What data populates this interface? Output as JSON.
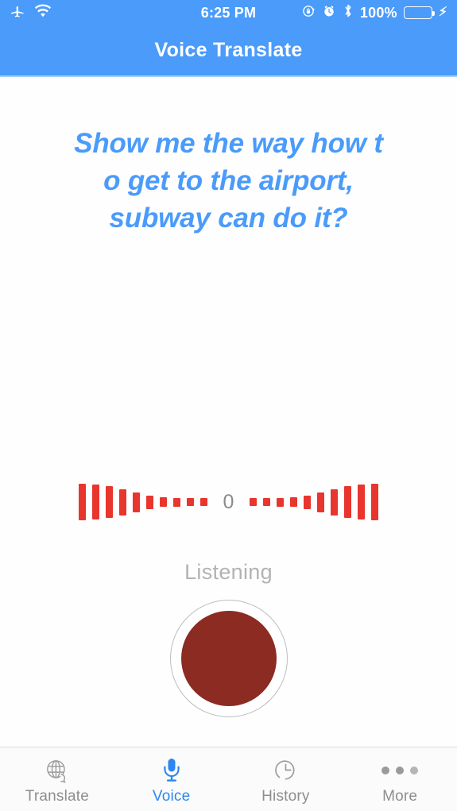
{
  "statusbar": {
    "airplane_icon": "airplane-icon",
    "wifi_icon": "wifi-icon",
    "time": "6:25 PM",
    "rotation_lock_icon": "rotation-lock-icon",
    "alarm_icon": "alarm-clock-icon",
    "bluetooth_icon": "bluetooth-icon",
    "battery_percent": "100%",
    "battery_fill_color": "#4cd963",
    "charging_icon": "lightning-bolt-icon"
  },
  "navbar": {
    "title": "Voice Translate",
    "background_color": "#4a9bfa"
  },
  "main": {
    "phrase": "Show me the way how to get to the airport, subway can do it?",
    "phrase_lines": [
      "Show me the way how t",
      "o get to the airport,",
      "subway can do it?"
    ],
    "phrase_color": "#4a9bfa",
    "level_value": "0",
    "status_text": "Listening",
    "status_color": "#b3b3b3",
    "waveform": {
      "bar_color": "#e8352e",
      "left_bar_heights": [
        46,
        44,
        40,
        33,
        25,
        17,
        12,
        11,
        10,
        10
      ],
      "right_bar_heights": [
        46,
        44,
        40,
        33,
        25,
        17,
        12,
        11,
        10,
        10
      ]
    },
    "record_button": {
      "name": "record-button",
      "fill_color": "#8b2b22",
      "ring_color": "#bdbdbd",
      "state": "recording"
    }
  },
  "tabbar": {
    "active_color": "#2e86f0",
    "inactive_color": "#8e8e8e",
    "items": [
      {
        "label": "Translate",
        "icon": "globe-speech-icon",
        "active": false
      },
      {
        "label": "Voice",
        "icon": "microphone-icon",
        "active": true
      },
      {
        "label": "History",
        "icon": "clock-icon",
        "active": false
      },
      {
        "label": "More",
        "icon": "ellipsis-icon",
        "active": false
      }
    ]
  }
}
